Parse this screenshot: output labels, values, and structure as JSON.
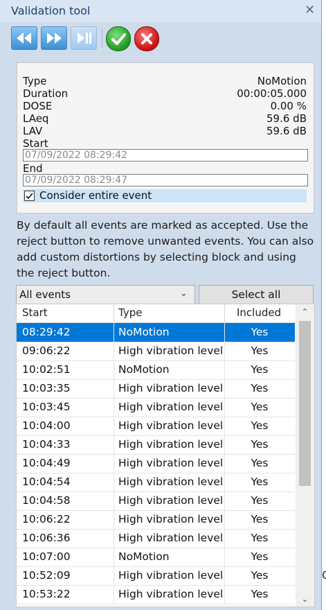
{
  "window": {
    "title": "Validation tool",
    "close_icon": "close-icon"
  },
  "toolbar": {
    "buttons": [
      {
        "name": "rewind-button",
        "icon": "rewind-icon"
      },
      {
        "name": "fast-forward-button",
        "icon": "fast-forward-icon"
      },
      {
        "name": "skip-end-button",
        "icon": "skip-end-icon"
      },
      {
        "name": "accept-button",
        "icon": "check-icon",
        "color": "#2aa52a"
      },
      {
        "name": "reject-button",
        "icon": "x-icon",
        "color": "#d81b1b"
      }
    ]
  },
  "info": {
    "type_label": "Type",
    "type_value": "NoMotion",
    "duration_label": "Duration",
    "duration_value": "00:00:05.000",
    "dose_label": "DOSE",
    "dose_value": "0.00 %",
    "laeq_label": "LAeq",
    "laeq_value": "59.6 dB",
    "lav_label": "LAV",
    "lav_value": "59.6 dB",
    "start_label": "Start",
    "start_value": "07/09/2022 08:29:42",
    "end_label": "End",
    "end_value": "07/09/2022 08:29:47",
    "consider_label": "Consider entire event",
    "consider_checked": true
  },
  "description": "By default all events are marked as accepted. Use the reject button to remove unwanted events. You can also add custom distortions by selecting block and using the reject button.",
  "filter": {
    "selected": "All events",
    "select_all_label": "Select all"
  },
  "table": {
    "headers": {
      "start": "Start",
      "type": "Type",
      "included": "Included"
    },
    "rows": [
      {
        "start": "08:29:42",
        "type": "NoMotion",
        "included": "Yes",
        "selected": true
      },
      {
        "start": "09:06:22",
        "type": "High vibration level",
        "included": "Yes"
      },
      {
        "start": "10:02:51",
        "type": "NoMotion",
        "included": "Yes"
      },
      {
        "start": "10:03:35",
        "type": "High vibration level",
        "included": "Yes"
      },
      {
        "start": "10:03:45",
        "type": "High vibration level",
        "included": "Yes"
      },
      {
        "start": "10:04:00",
        "type": "High vibration level",
        "included": "Yes"
      },
      {
        "start": "10:04:33",
        "type": "High vibration level",
        "included": "Yes"
      },
      {
        "start": "10:04:49",
        "type": "High vibration level",
        "included": "Yes"
      },
      {
        "start": "10:04:54",
        "type": "High vibration level",
        "included": "Yes"
      },
      {
        "start": "10:04:58",
        "type": "High vibration level",
        "included": "Yes"
      },
      {
        "start": "10:06:22",
        "type": "High vibration level",
        "included": "Yes"
      },
      {
        "start": "10:06:36",
        "type": "High vibration level",
        "included": "Yes"
      },
      {
        "start": "10:07:00",
        "type": "NoMotion",
        "included": "Yes"
      },
      {
        "start": "10:52:09",
        "type": "High vibration level",
        "included": "Yes"
      },
      {
        "start": "10:53:22",
        "type": "High vibration level",
        "included": "Yes"
      }
    ]
  },
  "side_text": "C",
  "colors": {
    "selection": "#0078d7",
    "title_text": "#1e3f6e",
    "panel_bg": "#cfdcec"
  }
}
